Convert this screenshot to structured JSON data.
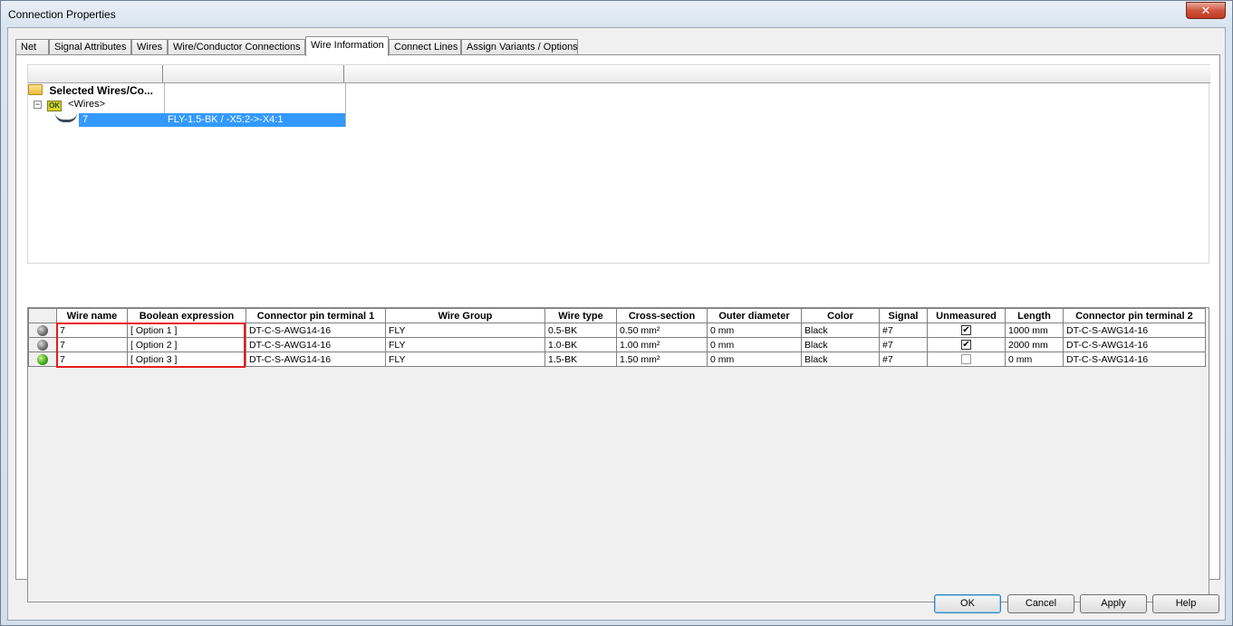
{
  "window": {
    "title": "Connection Properties",
    "close_label": "✕"
  },
  "tabs": [
    {
      "label": "Net"
    },
    {
      "label": "Signal Attributes"
    },
    {
      "label": "Wires"
    },
    {
      "label": "Wire/Conductor Connections"
    },
    {
      "label": "Wire Information"
    },
    {
      "label": "Connect Lines"
    },
    {
      "label": "Assign Variants / Options"
    }
  ],
  "active_tab": "Wire Information",
  "tree": {
    "root_label": "Selected Wires/Co...",
    "wires_label": "<Wires>",
    "bundle_icon_text": "OK",
    "item": {
      "name": "7",
      "description": "FLY-1.5-BK  /  -X5:2->-X4:1"
    }
  },
  "grid": {
    "columns": [
      "Wire name",
      "Boolean expression",
      "Connector pin terminal 1",
      "Wire Group",
      "Wire type",
      "Cross-section",
      "Outer diameter",
      "Color",
      "Signal",
      "Unmeasured",
      "Length",
      "Connector pin terminal 2"
    ],
    "rows": [
      {
        "status": "grey",
        "wire_name": "7",
        "boolean": "[ Option 1 ]",
        "pin1": "DT-C-S-AWG14-16",
        "group": "FLY",
        "type": "0.5-BK",
        "cross": "0.50 mm²",
        "outer": "0 mm",
        "color": "Black",
        "signal": "#7",
        "unmeasured": true,
        "length": "1000 mm",
        "pin2": "DT-C-S-AWG14-16"
      },
      {
        "status": "grey",
        "wire_name": "7",
        "boolean": "[ Option 2 ]",
        "pin1": "DT-C-S-AWG14-16",
        "group": "FLY",
        "type": "1.0-BK",
        "cross": "1.00 mm²",
        "outer": "0 mm",
        "color": "Black",
        "signal": "#7",
        "unmeasured": true,
        "length": "2000 mm",
        "pin2": "DT-C-S-AWG14-16"
      },
      {
        "status": "green",
        "wire_name": "7",
        "boolean": "[ Option 3 ]",
        "pin1": "DT-C-S-AWG14-16",
        "group": "FLY",
        "type": "1.5-BK",
        "cross": "1.50 mm²",
        "outer": "0 mm",
        "color": "Black",
        "signal": "#7",
        "unmeasured": false,
        "length": "0 mm",
        "pin2": "DT-C-S-AWG14-16"
      }
    ],
    "check_mark": "✔",
    "highlight_color": "#e8191c"
  },
  "buttons": {
    "ok": "OK",
    "cancel": "Cancel",
    "apply": "Apply",
    "help": "Help"
  }
}
